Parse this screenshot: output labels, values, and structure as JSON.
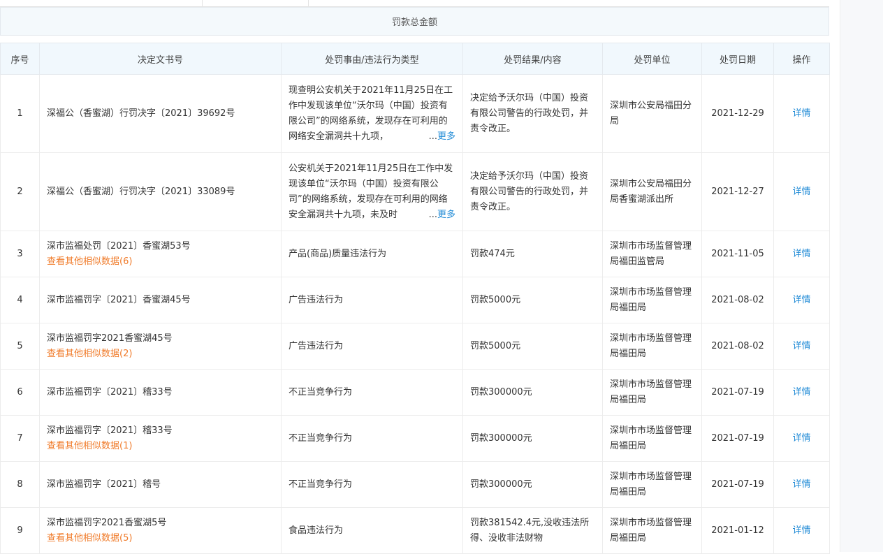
{
  "summary": {
    "total_label": "罚款总金额"
  },
  "table": {
    "headers": [
      "序号",
      "决定文书号",
      "处罚事由/违法行为类型",
      "处罚结果/内容",
      "处罚单位",
      "处罚日期",
      "操作"
    ],
    "detail_label": "详情",
    "more_label": "更多",
    "ellipsis": "...",
    "rows": [
      {
        "idx": "1",
        "doc": "深福公（香蜜湖）行罚决字〔2021〕39692号",
        "similar": "",
        "reason": "现查明公安机关于2021年11月25日在工作中发现该单位“沃尔玛（中国）投资有限公司”的网络系统，发现存在可利用的网络安全漏洞共十九项，",
        "result": "决定给予沃尔玛（中国）投资有限公司警告的行政处罚，并责令改正。",
        "unit": "深圳市公安局福田分局",
        "date": "2021-12-29"
      },
      {
        "idx": "2",
        "doc": "深福公（香蜜湖）行罚决字〔2021〕33089号",
        "similar": "",
        "reason": "公安机关于2021年11月25日在工作中发现该单位“沃尔玛（中国）投资有限公司”的网络系统，发现存在可利用的网络安全漏洞共十九项，未及时",
        "result": "决定给予沃尔玛（中国）投资有限公司警告的行政处罚，并责令改正。",
        "unit": "深圳市公安局福田分局香蜜湖派出所",
        "date": "2021-12-27"
      },
      {
        "idx": "3",
        "doc": "深市监福处罚〔2021〕香蜜湖53号",
        "similar": "查看其他相似数据(6)",
        "reason": "产品(商品)质量违法行为",
        "result": "罚款474元",
        "unit": "深圳市市场监督管理局福田监管局",
        "date": "2021-11-05"
      },
      {
        "idx": "4",
        "doc": "深市监福罚字〔2021〕香蜜湖45号",
        "similar": "",
        "reason": "广告违法行为",
        "result": "罚款5000元",
        "unit": "深圳市市场监督管理局福田局",
        "date": "2021-08-02"
      },
      {
        "idx": "5",
        "doc": "深市监福罚字2021香蜜湖45号",
        "similar": "查看其他相似数据(2)",
        "reason": "广告违法行为",
        "result": "罚款5000元",
        "unit": "深圳市市场监督管理局福田局",
        "date": "2021-08-02"
      },
      {
        "idx": "6",
        "doc": "深市监福罚字〔2021〕稽33号",
        "similar": "",
        "reason": "不正当竞争行为",
        "result": "罚款300000元",
        "unit": "深圳市市场监督管理局福田局",
        "date": "2021-07-19"
      },
      {
        "idx": "7",
        "doc": "深市监福罚字〔2021〕稽33号",
        "similar": "查看其他相似数据(1)",
        "reason": "不正当竞争行为",
        "result": "罚款300000元",
        "unit": "深圳市市场监督管理局福田局",
        "date": "2021-07-19"
      },
      {
        "idx": "8",
        "doc": "深市监福罚字〔2021〕稽号",
        "similar": "",
        "reason": "不正当竞争行为",
        "result": "罚款300000元",
        "unit": "深圳市市场监督管理局福田局",
        "date": "2021-07-19"
      },
      {
        "idx": "9",
        "doc": "深市监福罚字2021香蜜湖5号",
        "similar": "查看其他相似数据(5)",
        "reason": "食品违法行为",
        "result": "罚款381542.4元,没收违法所得、没收非法财物",
        "unit": "深圳市市场监督管理局福田局",
        "date": "2021-01-12"
      }
    ]
  }
}
